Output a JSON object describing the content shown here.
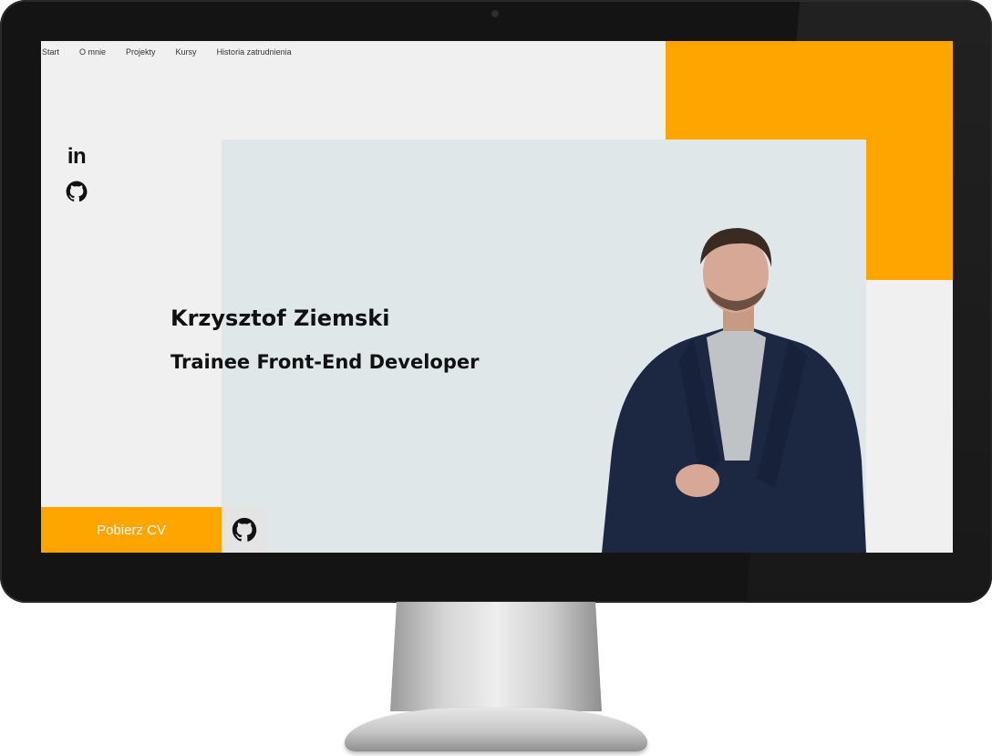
{
  "nav": {
    "items": [
      {
        "label": "Start"
      },
      {
        "label": "O mnie"
      },
      {
        "label": "Projekty"
      },
      {
        "label": "Kursy"
      },
      {
        "label": "Historia zatrudnienia"
      }
    ]
  },
  "social": {
    "linkedin_label": "in",
    "icons": [
      "linkedin-icon",
      "github-icon"
    ]
  },
  "hero": {
    "name": "Krzysztof Ziemski",
    "role": "Trainee Front-End Developer"
  },
  "actions": {
    "cv_label": "Pobierz CV",
    "github_icon": "github-icon"
  },
  "colors": {
    "accent": "#ffa500",
    "panel": "#dfe7e9",
    "page": "#f0f0f0",
    "text": "#111111",
    "bezel": "#141414"
  }
}
